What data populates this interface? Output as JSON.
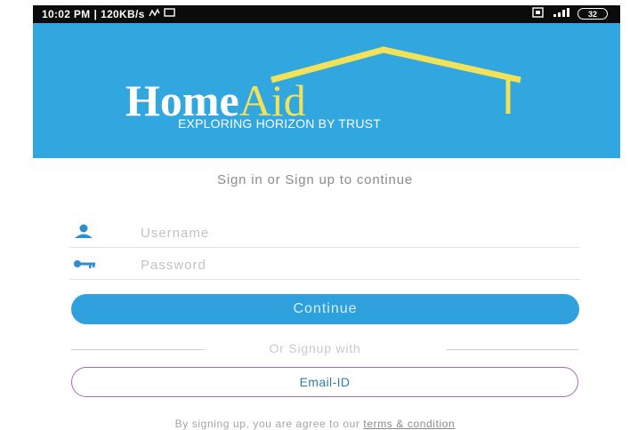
{
  "status_bar": {
    "time": "10:02 PM",
    "separator": "|",
    "speed": "120KB/s",
    "left_icons": [
      "activity-icon",
      "screen-icon"
    ],
    "right_icons": [
      "sim-icon",
      "signal-icon"
    ],
    "battery": "32"
  },
  "header": {
    "logo_home": "Home",
    "logo_aid": "Aid",
    "tagline": "EXPLORING HORIZON BY TRUST",
    "background_color": "#32a6de",
    "accent_color": "#f1e25a"
  },
  "main": {
    "subtitle": "Sign in or Sign up to continue",
    "username": {
      "icon": "user-icon",
      "placeholder": "Username",
      "value": ""
    },
    "password": {
      "icon": "key-icon",
      "placeholder": "Password",
      "value": ""
    },
    "continue_label": "Continue",
    "divider_text": "Or Signup with",
    "email_label": "Email-ID"
  },
  "footer": {
    "text": "By signing up, you are agree to our ",
    "link": "terms & condition"
  }
}
